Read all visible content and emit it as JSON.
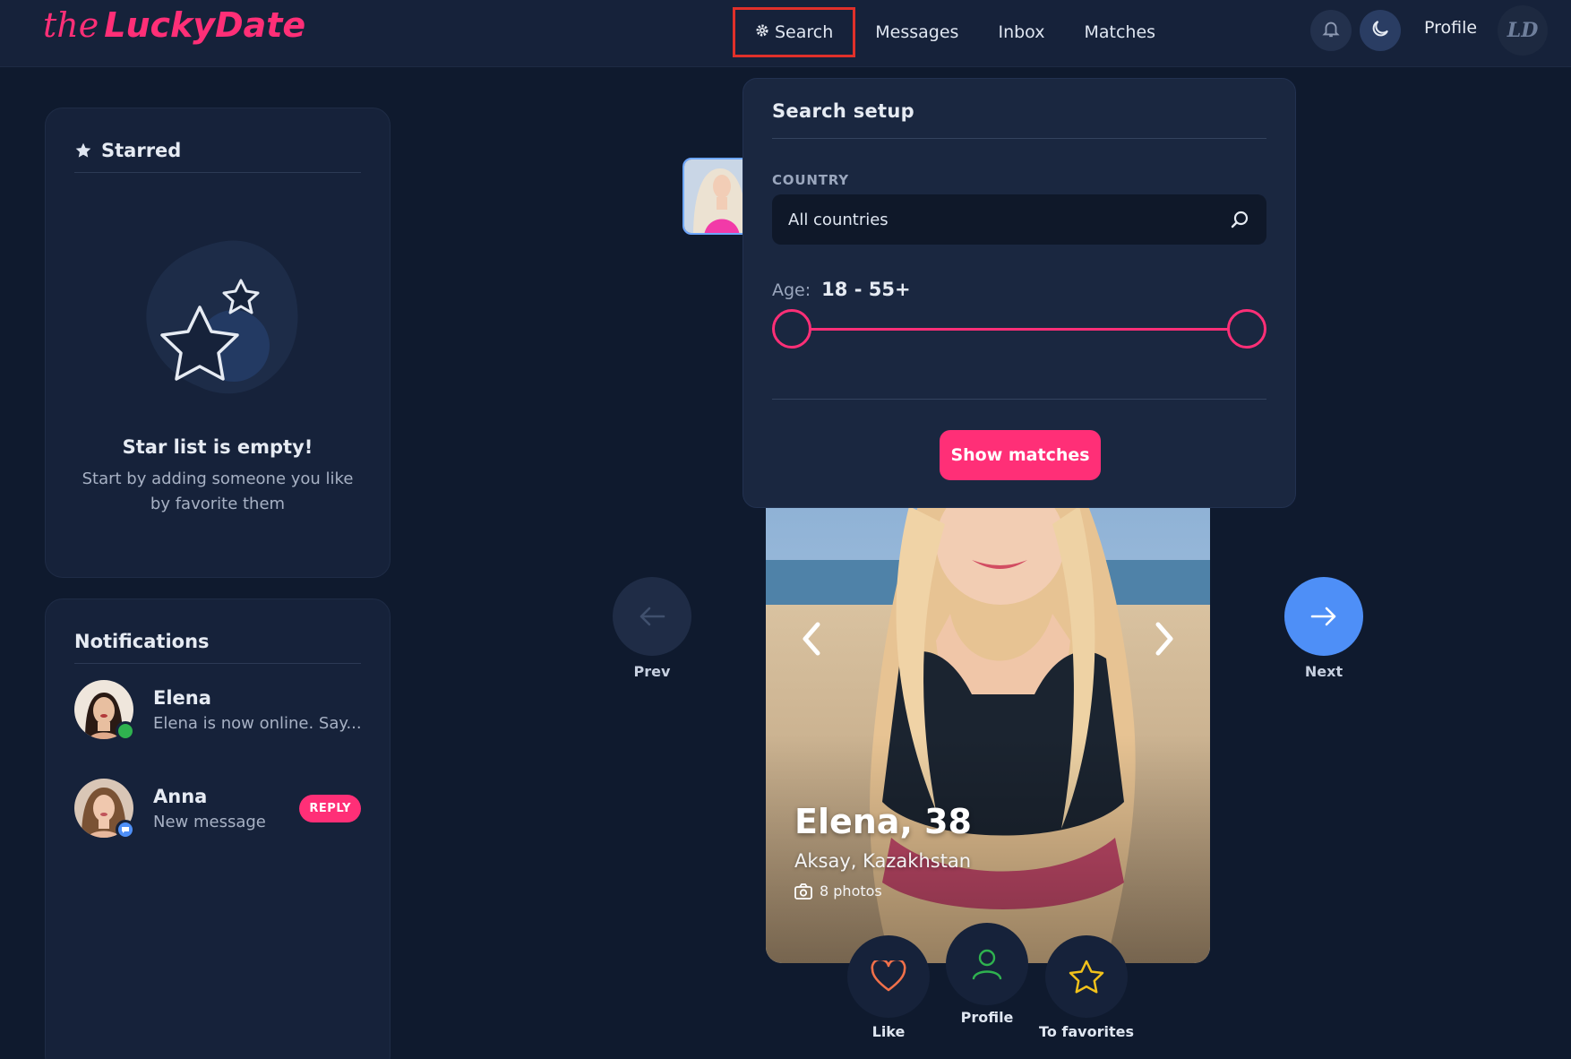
{
  "app": {
    "logo_prefix": "the",
    "logo_brand": "LuckyDate"
  },
  "topnav": {
    "items": [
      {
        "label": "Search",
        "active": true
      },
      {
        "label": "Messages",
        "active": false
      },
      {
        "label": "Inbox",
        "active": false
      },
      {
        "label": "Matches",
        "active": false
      }
    ],
    "profile_label": "Profile",
    "avatar_initials": "LD"
  },
  "starred": {
    "title": "Starred",
    "empty_title": "Star list is empty!",
    "empty_subtitle": "Start by adding someone you like by favorite them"
  },
  "notifications": {
    "title": "Notifications",
    "items": [
      {
        "name": "Elena",
        "message": "Elena is now online. Say...",
        "status": "online",
        "status_color": "#2fb24f"
      },
      {
        "name": "Anna",
        "message": "New message",
        "status": "message",
        "status_color": "#4e8ff7",
        "action_label": "REPLY"
      }
    ]
  },
  "search_setup": {
    "title": "Search setup",
    "country_label": "COUNTRY",
    "country_value": "All countries",
    "age_label": "Age:",
    "age_value": "18 - 55+",
    "age_min": 18,
    "age_max": "55+",
    "show_button_label": "Show matches"
  },
  "profile_card": {
    "name_age": "Elena, 38",
    "location": "Aksay, Kazakhstan",
    "photos_label": "8 photos"
  },
  "navigation": {
    "prev_label": "Prev",
    "next_label": "Next"
  },
  "actions": {
    "like_label": "Like",
    "profile_label": "Profile",
    "favorites_label": "To favorites"
  },
  "colors": {
    "accent": "#ff2f77",
    "next_button": "#4e8ff7",
    "background": "#0f1a2e",
    "highlight_outline": "#e0302a"
  }
}
